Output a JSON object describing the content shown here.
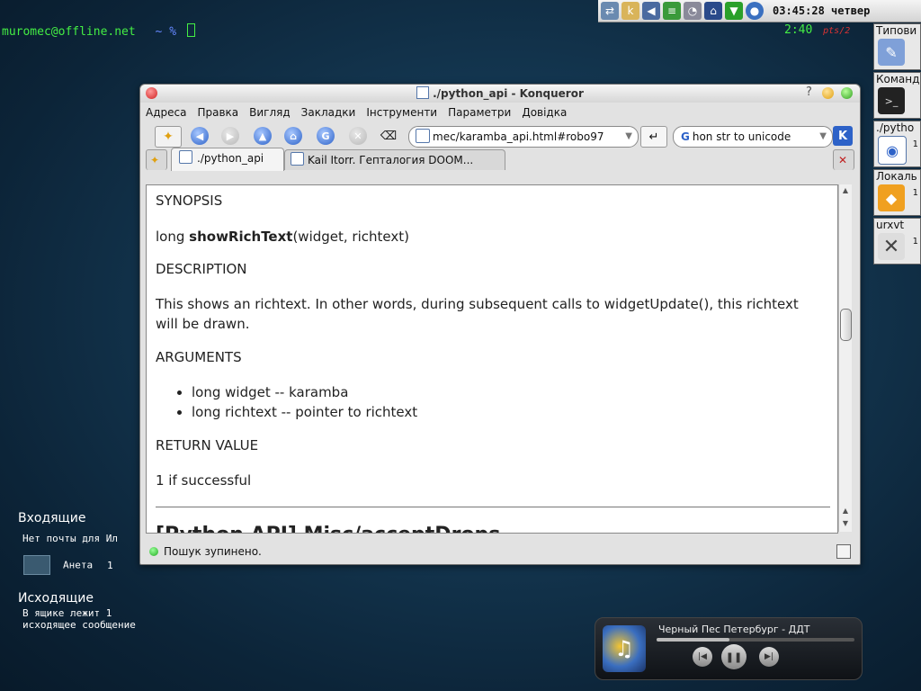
{
  "terminal": {
    "prompt": "muromec@offline.net",
    "tilde": "~ %",
    "clock": "2:40",
    "pts": "pts/2"
  },
  "tray": {
    "clock": "03:45:28 четвер",
    "icons": [
      "network-icon",
      "kde-icon",
      "volume-icon",
      "keyboard-layout-icon",
      "disk-icon",
      "updater-icon",
      "download-icon",
      "globe-icon"
    ]
  },
  "taskbar": [
    {
      "label": "Типови",
      "icon": "brush-icon",
      "count": ""
    },
    {
      "label": "Команд",
      "icon": "terminal-icon",
      "count": ""
    },
    {
      "label": "./pytho",
      "icon": "konqueror-icon",
      "count": "1"
    },
    {
      "label": "Локаль",
      "icon": "folder-icon",
      "count": "1"
    },
    {
      "label": "urxvt",
      "icon": "x-icon",
      "count": "1"
    }
  ],
  "mail": {
    "inbox_title": "Входящие",
    "inbox_text": "Нет почты для Ил",
    "contact": "Анета",
    "contact_count": "1",
    "outbox_title": "Исходящие",
    "outbox_line1": "В ящике лежит 1",
    "outbox_line2": "исходящее сообщение"
  },
  "player": {
    "song": "Черный Пес Петербург - ДДТ",
    "progress": 0.37
  },
  "window": {
    "title": "./python_api - Konqueror",
    "menu": [
      "Адреса",
      "Правка",
      "Вигляд",
      "Закладки",
      "Інструменти",
      "Параметри",
      "Довідка"
    ],
    "url": "mec/karamba_api.html#robo97",
    "search": "hon str to unicode",
    "tabs": [
      "./python_api",
      "Kail Itorr. Гепталогия DOOM..."
    ],
    "status": "Пошук зупинено."
  },
  "doc": {
    "synopsis_h": "SYNOPSIS",
    "synopsis_pre": "long ",
    "synopsis_fn": "showRichText",
    "synopsis_args": "(widget, richtext)",
    "description_h": "DESCRIPTION",
    "description": "This shows an richtext. In other words, during subsequent calls to widgetUpdate(), this richtext will be drawn.",
    "arguments_h": "ARGUMENTS",
    "arguments": [
      "long widget -- karamba",
      "long richtext -- pointer to richtext"
    ],
    "return_h": "RETURN VALUE",
    "return": "1 if successful",
    "next_heading": "[Python API] Misc/acceptDrops"
  },
  "colors": {
    "accent_green": "#44ee44",
    "desktop_bg": "#153a55"
  }
}
